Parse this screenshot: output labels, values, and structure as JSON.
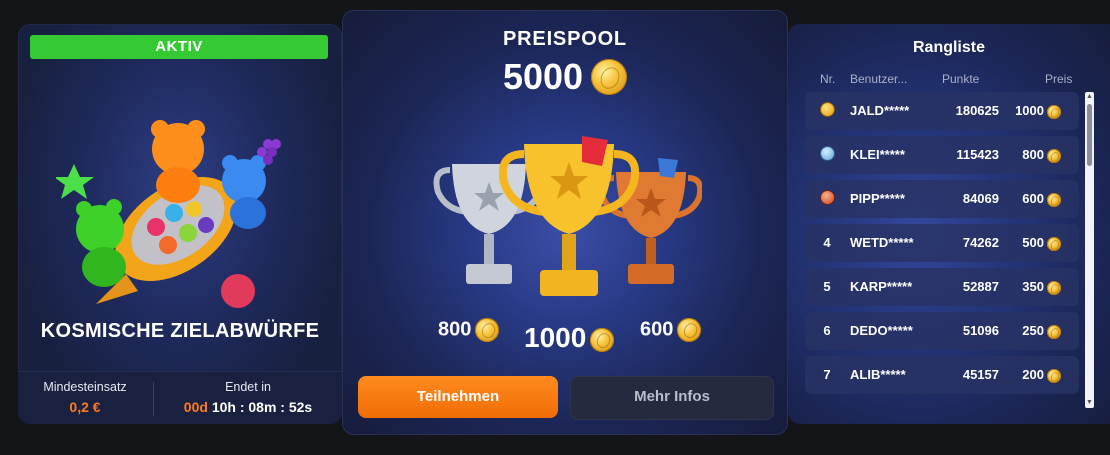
{
  "game": {
    "status": "AKTIV",
    "title": "KOSMISCHE ZIELABWÜRFE",
    "min_bet_label": "Mindesteinsatz",
    "min_bet_value": "0,2 €",
    "ends_label": "Endet in",
    "days": "00d",
    "time": "10h : 08m : 52s"
  },
  "pool": {
    "label": "PREISPOOL",
    "amount": "5000",
    "prize_second": "800",
    "prize_first": "1000",
    "prize_third": "600",
    "join_label": "Teilnehmen",
    "info_label": "Mehr Infos"
  },
  "leaderboard": {
    "title": "Rangliste",
    "col_rank": "Nr.",
    "col_user": "Benutzer...",
    "col_points": "Punkte",
    "col_prize": "Preis",
    "rows": [
      {
        "rank": "",
        "medal": "gold",
        "user": "JALD*****",
        "points": "180625",
        "prize": "1000"
      },
      {
        "rank": "",
        "medal": "silver",
        "user": "KLEI*****",
        "points": "115423",
        "prize": "800"
      },
      {
        "rank": "",
        "medal": "bronze",
        "user": "PIPP*****",
        "points": "84069",
        "prize": "600"
      },
      {
        "rank": "4",
        "medal": "",
        "user": "WETD*****",
        "points": "74262",
        "prize": "500"
      },
      {
        "rank": "5",
        "medal": "",
        "user": "KARP*****",
        "points": "52887",
        "prize": "350"
      },
      {
        "rank": "6",
        "medal": "",
        "user": "DEDO*****",
        "points": "51096",
        "prize": "250"
      },
      {
        "rank": "7",
        "medal": "",
        "user": "ALIB*****",
        "points": "45157",
        "prize": "200"
      }
    ]
  },
  "colors": {
    "accent": "#ff7a1a",
    "status": "#35c934"
  },
  "icons": [
    "coin-icon",
    "gold-medal-icon",
    "silver-medal-icon",
    "bronze-medal-icon",
    "trophy-icon"
  ]
}
